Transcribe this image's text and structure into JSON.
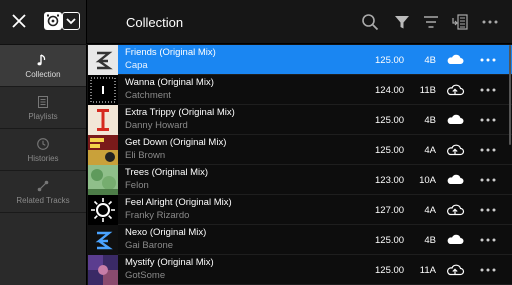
{
  "header": {
    "title": "Collection",
    "icons": [
      "close-icon",
      "device-icon",
      "chevron-down-icon",
      "search-icon",
      "filter-icon",
      "sort-icon",
      "column-view-icon",
      "more-icon"
    ]
  },
  "sidebar": {
    "items": [
      {
        "label": "Collection",
        "icon": "music-note-icon",
        "active": true
      },
      {
        "label": "Playlists",
        "icon": "playlist-icon",
        "active": false
      },
      {
        "label": "Histories",
        "icon": "clock-icon",
        "active": false
      },
      {
        "label": "Related Tracks",
        "icon": "related-icon",
        "active": false
      }
    ]
  },
  "tracks": [
    {
      "title": "Friends (Original Mix)",
      "artist": "Capa",
      "bpm": "125.00",
      "key": "4B",
      "cloud": "cloud-synced-icon",
      "selected": true
    },
    {
      "title": "Wanna (Original Mix)",
      "artist": "Catchment",
      "bpm": "124.00",
      "key": "11B",
      "cloud": "cloud-upload-icon",
      "selected": false
    },
    {
      "title": "Extra Trippy (Original Mix)",
      "artist": "Danny Howard",
      "bpm": "125.00",
      "key": "4B",
      "cloud": "cloud-synced-icon",
      "selected": false
    },
    {
      "title": "Get Down (Original Mix)",
      "artist": "Eli Brown",
      "bpm": "125.00",
      "key": "4A",
      "cloud": "cloud-upload-icon",
      "selected": false
    },
    {
      "title": "Trees (Original Mix)",
      "artist": "Felon",
      "bpm": "123.00",
      "key": "10A",
      "cloud": "cloud-synced-icon",
      "selected": false
    },
    {
      "title": "Feel Alright (Original Mix)",
      "artist": "Franky Rizardo",
      "bpm": "127.00",
      "key": "4A",
      "cloud": "cloud-upload-icon",
      "selected": false
    },
    {
      "title": "Nexo (Original Mix)",
      "artist": "Gai Barone",
      "bpm": "125.00",
      "key": "4B",
      "cloud": "cloud-synced-icon",
      "selected": false
    },
    {
      "title": "Mystify (Original Mix)",
      "artist": "GotSome",
      "bpm": "125.00",
      "key": "11A",
      "cloud": "cloud-upload-icon",
      "selected": false
    }
  ],
  "colors": {
    "accent": "#1a86f2",
    "background": "#0d0d0d",
    "sidebar": "#2a2a2a"
  }
}
